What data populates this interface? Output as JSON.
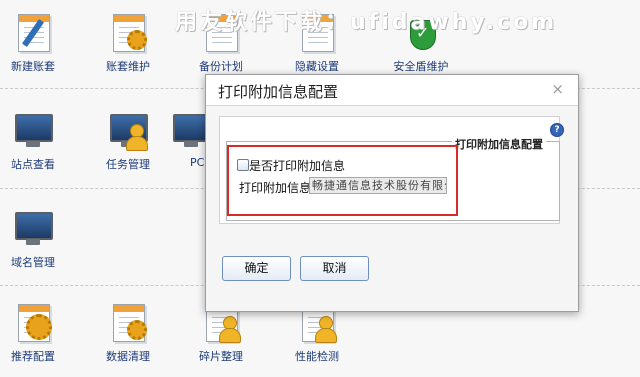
{
  "watermark": "用友软件下载：ufidawhy.com",
  "desktop": {
    "tiles": [
      {
        "label": "新建账套"
      },
      {
        "label": "账套维护"
      },
      {
        "label": "备份计划"
      },
      {
        "label": "隐藏设置"
      },
      {
        "label": "安全盾维护"
      },
      {
        "label": "站点查看"
      },
      {
        "label": "任务管理"
      },
      {
        "label": "PC"
      },
      {
        "label": "域名管理"
      },
      {
        "label": "推荐配置"
      },
      {
        "label": "数据清理"
      },
      {
        "label": "碎片整理"
      },
      {
        "label": "性能检测"
      }
    ]
  },
  "dialog": {
    "title": "打印附加信息配置",
    "close": "×",
    "legend": "打印附加信息配置",
    "help": "?",
    "checkbox_label": "是否打印附加信息",
    "checkbox_checked": false,
    "field_label": "打印附加信息",
    "field_value": "畅捷通信息技术股份有限公",
    "ok_label": "确定",
    "cancel_label": "取消"
  },
  "colors": {
    "highlight": "#d92a2a",
    "label_blue": "#1d3a78"
  }
}
